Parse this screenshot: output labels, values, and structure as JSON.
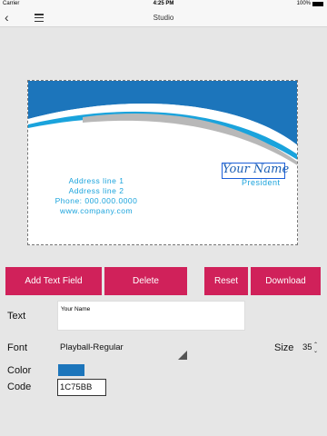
{
  "status": {
    "carrier": "Carrier",
    "time": "4:25 PM",
    "battery": "100%"
  },
  "nav": {
    "title": "Studio",
    "back_icon": "chevron-left-icon",
    "menu_icon": "hamburger-menu-icon"
  },
  "card": {
    "address_line1": "Address line 1",
    "address_line2": "Address line 2",
    "phone": "Phone: 000.000.0000",
    "website": "www.company.com",
    "name": "Your Name",
    "role": "President",
    "accent_color": "#1c75bb",
    "swoosh_color": "#1aa3dc"
  },
  "buttons": {
    "add_text_field": "Add Text Field",
    "delete": "Delete",
    "reset": "Reset",
    "download": "Download",
    "color": "#d0215a"
  },
  "form": {
    "text_label": "Text",
    "text_value": "Your Name",
    "font_label": "Font",
    "font_value": "Playball-Regular",
    "size_label": "Size",
    "size_value": "35",
    "color_label": "Color",
    "color_value": "#1c75bb",
    "code_label": "Code",
    "code_value": "1C75BB"
  }
}
